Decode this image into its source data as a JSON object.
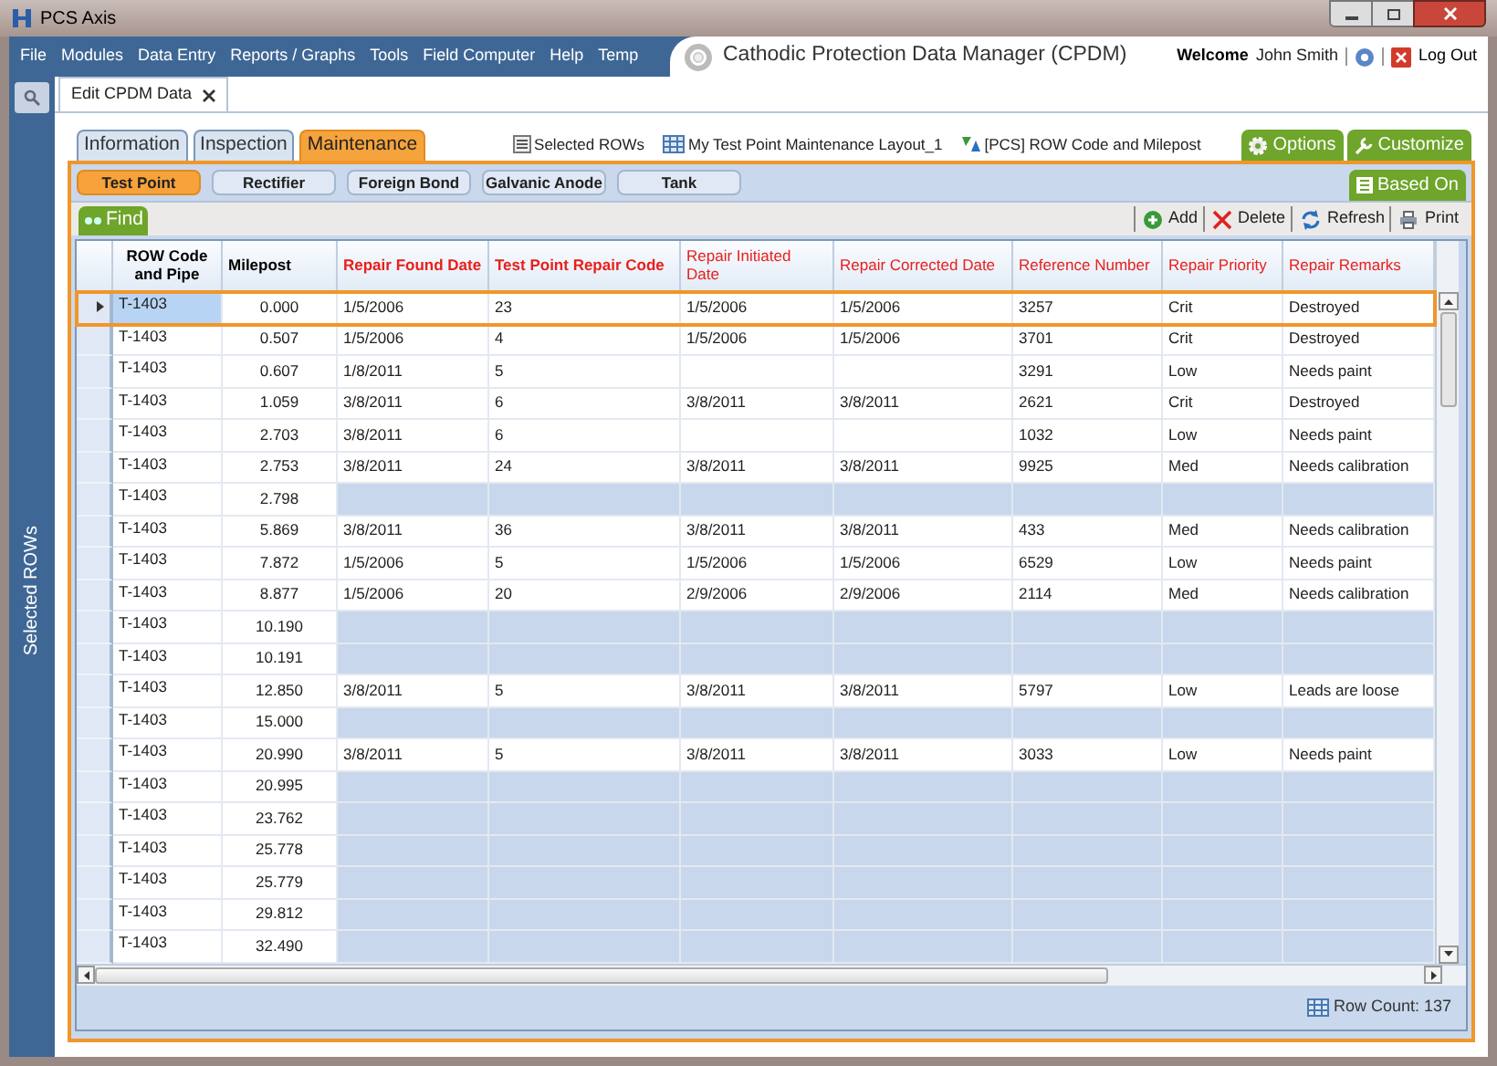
{
  "window": {
    "title": "PCS Axis"
  },
  "menu": [
    "File",
    "Modules",
    "Data Entry",
    "Reports / Graphs",
    "Tools",
    "Field Computer",
    "Help",
    "Temp"
  ],
  "header": {
    "title": "Cathodic Protection Data Manager (CPDM)",
    "welcome_label": "Welcome",
    "user": "John Smith",
    "logout": "Log Out"
  },
  "document_tab": {
    "label": "Edit CPDM Data"
  },
  "side_panel": {
    "label": "Selected ROWs"
  },
  "tabs": [
    {
      "label": "Information",
      "selected": false
    },
    {
      "label": "Inspection",
      "selected": false
    },
    {
      "label": "Maintenance",
      "selected": true
    }
  ],
  "toolbar_links": [
    {
      "kind": "selection",
      "label": "Selected ROWs"
    },
    {
      "kind": "layout",
      "label": "My Test Point Maintenance Layout_1"
    },
    {
      "kind": "filter",
      "label": "[PCS] ROW Code and Milepost"
    }
  ],
  "right_tabs": [
    {
      "kind": "gear",
      "label": "Options"
    },
    {
      "kind": "wrench",
      "label": "Customize"
    }
  ],
  "subtabs": [
    {
      "label": "Test Point",
      "selected": true
    },
    {
      "label": "Rectifier",
      "selected": false
    },
    {
      "label": "Foreign Bond",
      "selected": false
    },
    {
      "label": "Galvanic Anode",
      "selected": false
    },
    {
      "label": "Tank",
      "selected": false
    }
  ],
  "based_on": "Based On",
  "find": "Find",
  "actions": [
    {
      "kind": "add",
      "label": "Add"
    },
    {
      "kind": "delete",
      "label": "Delete"
    },
    {
      "kind": "refresh",
      "label": "Refresh"
    },
    {
      "kind": "print",
      "label": "Print"
    }
  ],
  "table": {
    "columns": [
      {
        "label": "ROW Code and Pipe",
        "kind": "key"
      },
      {
        "label": "Milepost",
        "kind": "key"
      },
      {
        "label": "Repair Found Date",
        "kind": "required"
      },
      {
        "label": "Test Point Repair Code",
        "kind": "required"
      },
      {
        "label": "Repair Initiated Date",
        "kind": "optional"
      },
      {
        "label": "Repair Corrected Date",
        "kind": "optional"
      },
      {
        "label": "Reference Number",
        "kind": "optional"
      },
      {
        "label": "Repair Priority",
        "kind": "optional"
      },
      {
        "label": "Repair Remarks",
        "kind": "optional"
      }
    ],
    "rows": [
      {
        "selected": true,
        "kind": "record",
        "cells": [
          "T-1403",
          "0.000",
          "1/5/2006",
          "23",
          "1/5/2006",
          "1/5/2006",
          "3257",
          "Crit",
          "Destroyed"
        ]
      },
      {
        "selected": false,
        "kind": "record",
        "cells": [
          "T-1403",
          "0.507",
          "1/5/2006",
          "4",
          "1/5/2006",
          "1/5/2006",
          "3701",
          "Crit",
          "Destroyed"
        ]
      },
      {
        "selected": false,
        "kind": "record",
        "cells": [
          "T-1403",
          "0.607",
          "1/8/2011",
          "5",
          null,
          null,
          "3291",
          "Low",
          "Needs paint"
        ]
      },
      {
        "selected": false,
        "kind": "record",
        "cells": [
          "T-1403",
          "1.059",
          "3/8/2011",
          "6",
          "3/8/2011",
          "3/8/2011",
          "2621",
          "Crit",
          "Destroyed"
        ]
      },
      {
        "selected": false,
        "kind": "record",
        "cells": [
          "T-1403",
          "2.703",
          "3/8/2011",
          "6",
          null,
          null,
          "1032",
          "Low",
          "Needs paint"
        ]
      },
      {
        "selected": false,
        "kind": "record",
        "cells": [
          "T-1403",
          "2.753",
          "3/8/2011",
          "24",
          "3/8/2011",
          "3/8/2011",
          "9925",
          "Med",
          "Needs calibration"
        ]
      },
      {
        "selected": false,
        "kind": "empty",
        "cells": [
          "T-1403",
          "2.798"
        ]
      },
      {
        "selected": false,
        "kind": "record",
        "cells": [
          "T-1403",
          "5.869",
          "3/8/2011",
          "36",
          "3/8/2011",
          "3/8/2011",
          "433",
          "Med",
          "Needs calibration"
        ]
      },
      {
        "selected": false,
        "kind": "record",
        "cells": [
          "T-1403",
          "7.872",
          "1/5/2006",
          "5",
          "1/5/2006",
          "1/5/2006",
          "6529",
          "Low",
          "Needs paint"
        ]
      },
      {
        "selected": false,
        "kind": "record",
        "cells": [
          "T-1403",
          "8.877",
          "1/5/2006",
          "20",
          "2/9/2006",
          "2/9/2006",
          "2114",
          "Med",
          "Needs calibration"
        ]
      },
      {
        "selected": false,
        "kind": "empty",
        "cells": [
          "T-1403",
          "10.190"
        ]
      },
      {
        "selected": false,
        "kind": "empty",
        "cells": [
          "T-1403",
          "10.191"
        ]
      },
      {
        "selected": false,
        "kind": "record",
        "cells": [
          "T-1403",
          "12.850",
          "3/8/2011",
          "5",
          "3/8/2011",
          "3/8/2011",
          "5797",
          "Low",
          "Leads are loose"
        ]
      },
      {
        "selected": false,
        "kind": "empty",
        "cells": [
          "T-1403",
          "15.000"
        ]
      },
      {
        "selected": false,
        "kind": "record",
        "cells": [
          "T-1403",
          "20.990",
          "3/8/2011",
          "5",
          "3/8/2011",
          "3/8/2011",
          "3033",
          "Low",
          "Needs paint"
        ]
      },
      {
        "selected": false,
        "kind": "empty",
        "cells": [
          "T-1403",
          "20.995"
        ]
      },
      {
        "selected": false,
        "kind": "empty",
        "cells": [
          "T-1403",
          "23.762"
        ]
      },
      {
        "selected": false,
        "kind": "empty",
        "cells": [
          "T-1403",
          "25.778"
        ]
      },
      {
        "selected": false,
        "kind": "empty",
        "cells": [
          "T-1403",
          "25.779"
        ]
      },
      {
        "selected": false,
        "kind": "empty",
        "cells": [
          "T-1403",
          "29.812"
        ]
      },
      {
        "selected": false,
        "kind": "empty",
        "cells": [
          "T-1403",
          "32.490"
        ]
      }
    ]
  },
  "status_bar": {
    "row_count": "Row Count: 137"
  }
}
